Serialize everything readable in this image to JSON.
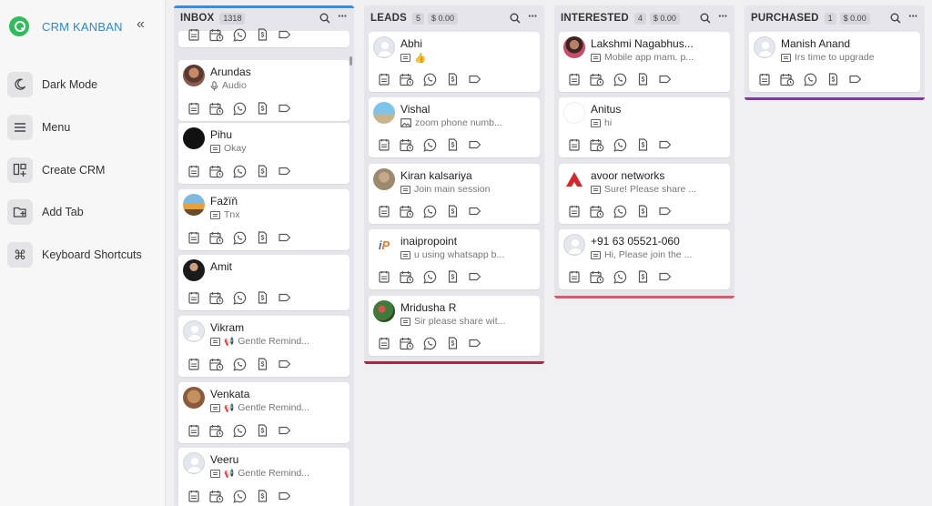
{
  "sidebar": {
    "title": "CRM KANBAN",
    "collapse_icon": "«",
    "items": [
      {
        "label": "Dark Mode",
        "icon": "moon-icon"
      },
      {
        "label": "Menu",
        "icon": "menu-icon"
      },
      {
        "label": "Create CRM",
        "icon": "create-crm-icon"
      },
      {
        "label": "Add Tab",
        "icon": "add-tab-icon"
      },
      {
        "label": "Keyboard Shortcuts",
        "icon": "command-icon"
      }
    ]
  },
  "columns": [
    {
      "title": "INBOX",
      "count": "1318",
      "amount": "",
      "color": "#3b8be0",
      "cards": [
        {
          "name": "",
          "message": "",
          "avatar": "none"
        },
        {
          "name": "Arundas",
          "message": "Audio",
          "msg_icon": "mic",
          "avatar": "photo"
        },
        {
          "name": "Pihu",
          "message": "Okay",
          "avatar": "dark"
        },
        {
          "name": "Fažïň",
          "message": "Tnx",
          "avatar": "photo2"
        },
        {
          "name": "Amit",
          "message": "",
          "avatar": "photo3"
        },
        {
          "name": "Vikram",
          "message": "Gentle Remind...",
          "msg_prefix": "📢",
          "avatar": "default"
        },
        {
          "name": "Venkata",
          "message": "Gentle Remind...",
          "msg_prefix": "📢",
          "avatar": "photo4"
        },
        {
          "name": "Veeru",
          "message": "Gentle Remind...",
          "msg_prefix": "📢",
          "avatar": "default"
        }
      ]
    },
    {
      "title": "LEADS",
      "count": "5",
      "amount": "$ 0.00",
      "color": "#b0243c",
      "cards": [
        {
          "name": "Abhi",
          "message": "👍",
          "avatar": "default"
        },
        {
          "name": "Vishal",
          "message": "zoom phone numb...",
          "msg_icon": "image",
          "avatar": "photo5"
        },
        {
          "name": "Kiran kalsariya",
          "message": "Join main session",
          "avatar": "photo6"
        },
        {
          "name": "inaipropoint",
          "message": "u using whatsapp b...",
          "avatar": "logo-ip"
        },
        {
          "name": "Mridusha R",
          "message": "Sir please share wit...",
          "avatar": "photo7"
        }
      ]
    },
    {
      "title": "INTERESTED",
      "count": "4",
      "amount": "$ 0.00",
      "color": "#e0566e",
      "cards": [
        {
          "name": "Lakshmi Nagabhus...",
          "message": "Mobile app mam. p...",
          "avatar": "photo8"
        },
        {
          "name": "Anitus",
          "message": "hi",
          "avatar": "blank"
        },
        {
          "name": "avoor networks",
          "message": "Sure! Please share ...",
          "avatar": "logo-a"
        },
        {
          "name": "+91 63 05521-060",
          "message": "Hi, Please join the ...",
          "avatar": "default"
        }
      ]
    },
    {
      "title": "PURCHASED",
      "count": "1",
      "amount": "$ 0.00",
      "color": "#7a3aa8",
      "cards": [
        {
          "name": "Manish Anand",
          "message": "Irs time to upgrade",
          "avatar": "default"
        }
      ]
    }
  ]
}
